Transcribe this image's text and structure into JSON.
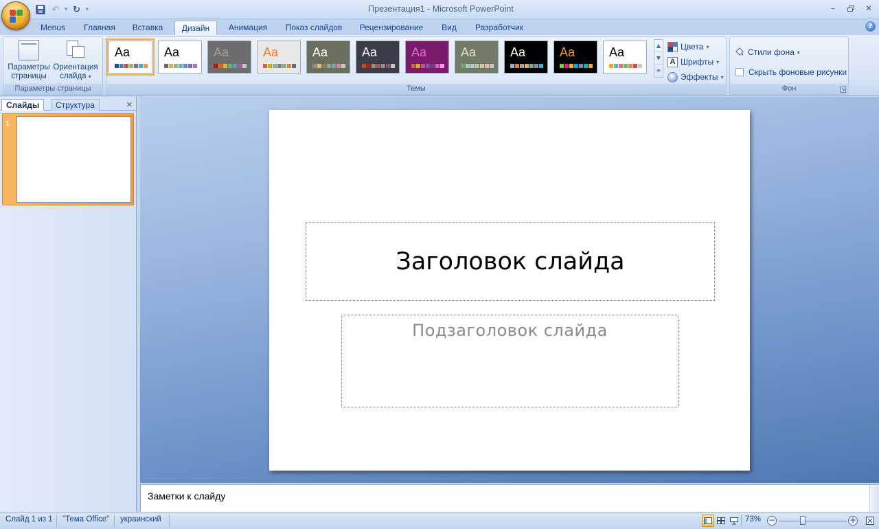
{
  "window": {
    "title": "Презентация1 - Microsoft PowerPoint"
  },
  "ribbon_tabs": [
    {
      "label": "Menus"
    },
    {
      "label": "Главная"
    },
    {
      "label": "Вставка"
    },
    {
      "label": "Дизайн",
      "active": true
    },
    {
      "label": "Анимация"
    },
    {
      "label": "Показ слайдов"
    },
    {
      "label": "Рецензирование"
    },
    {
      "label": "Вид"
    },
    {
      "label": "Разработчик"
    }
  ],
  "page_setup_group": {
    "page_params_label_1": "Параметры",
    "page_params_label_2": "страницы",
    "orientation_label_1": "Ориентация",
    "orientation_label_2": "слайда",
    "group_label": "Параметры страницы"
  },
  "themes_group": {
    "group_label": "Темы",
    "themes": [
      {
        "name": "office",
        "sample": "Aa",
        "bg": "#ffffff",
        "fg": "#000000",
        "selected": true
      },
      {
        "name": "apex",
        "sample": "Aa",
        "bg": "#ffffff",
        "fg": "#000000"
      },
      {
        "name": "aspect",
        "sample": "Aa",
        "bg": "#6d6d6d",
        "fg": "#a0a0a0"
      },
      {
        "name": "civic",
        "sample": "Aa",
        "bg": "#e8e8e8",
        "fg": "#f07a2c"
      },
      {
        "name": "concourse",
        "sample": "Aa",
        "bg": "#6b6f5e",
        "fg": "#ffffff"
      },
      {
        "name": "equity",
        "sample": "Aa",
        "bg": "#3a3c4a",
        "fg": "#ffffff"
      },
      {
        "name": "flow",
        "sample": "Aa",
        "bg": "#7a1b6b",
        "fg": "#e06bd0"
      },
      {
        "name": "foundry",
        "sample": "Aa",
        "bg": "#727a68",
        "fg": "#dfe4c8"
      },
      {
        "name": "median",
        "sample": "Aa",
        "bg": "#000000",
        "fg": "#ffffff"
      },
      {
        "name": "metro",
        "sample": "Aa",
        "bg": "#000000",
        "fg": "#f5a623"
      },
      {
        "name": "module",
        "sample": "Aa",
        "bg": "#ffffff",
        "fg": "#000000"
      }
    ],
    "colors_label": "Цвета",
    "fonts_label": "Шрифты",
    "effects_label": "Эффекты"
  },
  "background_group": {
    "styles_label": "Стили фона",
    "hide_graphics_label": "Скрыть фоновые рисунки",
    "group_label": "Фон"
  },
  "left_pane": {
    "tab_slides": "Слайды",
    "tab_outline": "Структура",
    "slide_number": "1"
  },
  "slide": {
    "title": "Заголовок слайда",
    "subtitle": "Подзаголовок слайда"
  },
  "notes": {
    "placeholder": "Заметки к слайду"
  },
  "status_bar": {
    "slide_info": "Слайд 1 из 1",
    "theme": "\"Тема Office\"",
    "language": "украинский",
    "zoom": "73%"
  },
  "colors": {
    "ribbon_accent": "#15428b",
    "selection": "#f29a3b"
  }
}
